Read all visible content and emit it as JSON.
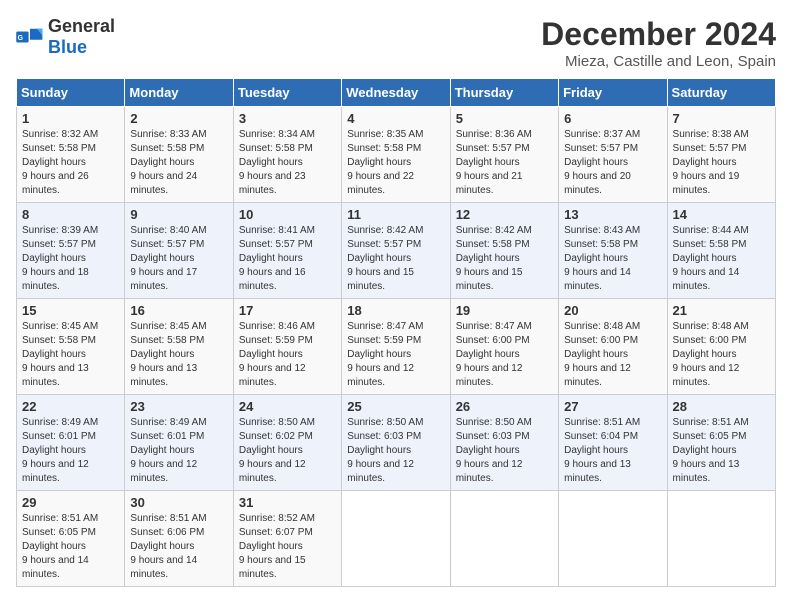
{
  "header": {
    "logo_general": "General",
    "logo_blue": "Blue",
    "title": "December 2024",
    "location": "Mieza, Castille and Leon, Spain"
  },
  "days_of_week": [
    "Sunday",
    "Monday",
    "Tuesday",
    "Wednesday",
    "Thursday",
    "Friday",
    "Saturday"
  ],
  "weeks": [
    [
      {
        "day": "1",
        "sunrise": "8:32 AM",
        "sunset": "5:58 PM",
        "daylight": "9 hours and 26 minutes."
      },
      {
        "day": "2",
        "sunrise": "8:33 AM",
        "sunset": "5:58 PM",
        "daylight": "9 hours and 24 minutes."
      },
      {
        "day": "3",
        "sunrise": "8:34 AM",
        "sunset": "5:58 PM",
        "daylight": "9 hours and 23 minutes."
      },
      {
        "day": "4",
        "sunrise": "8:35 AM",
        "sunset": "5:58 PM",
        "daylight": "9 hours and 22 minutes."
      },
      {
        "day": "5",
        "sunrise": "8:36 AM",
        "sunset": "5:57 PM",
        "daylight": "9 hours and 21 minutes."
      },
      {
        "day": "6",
        "sunrise": "8:37 AM",
        "sunset": "5:57 PM",
        "daylight": "9 hours and 20 minutes."
      },
      {
        "day": "7",
        "sunrise": "8:38 AM",
        "sunset": "5:57 PM",
        "daylight": "9 hours and 19 minutes."
      }
    ],
    [
      {
        "day": "8",
        "sunrise": "8:39 AM",
        "sunset": "5:57 PM",
        "daylight": "9 hours and 18 minutes."
      },
      {
        "day": "9",
        "sunrise": "8:40 AM",
        "sunset": "5:57 PM",
        "daylight": "9 hours and 17 minutes."
      },
      {
        "day": "10",
        "sunrise": "8:41 AM",
        "sunset": "5:57 PM",
        "daylight": "9 hours and 16 minutes."
      },
      {
        "day": "11",
        "sunrise": "8:42 AM",
        "sunset": "5:57 PM",
        "daylight": "9 hours and 15 minutes."
      },
      {
        "day": "12",
        "sunrise": "8:42 AM",
        "sunset": "5:58 PM",
        "daylight": "9 hours and 15 minutes."
      },
      {
        "day": "13",
        "sunrise": "8:43 AM",
        "sunset": "5:58 PM",
        "daylight": "9 hours and 14 minutes."
      },
      {
        "day": "14",
        "sunrise": "8:44 AM",
        "sunset": "5:58 PM",
        "daylight": "9 hours and 14 minutes."
      }
    ],
    [
      {
        "day": "15",
        "sunrise": "8:45 AM",
        "sunset": "5:58 PM",
        "daylight": "9 hours and 13 minutes."
      },
      {
        "day": "16",
        "sunrise": "8:45 AM",
        "sunset": "5:58 PM",
        "daylight": "9 hours and 13 minutes."
      },
      {
        "day": "17",
        "sunrise": "8:46 AM",
        "sunset": "5:59 PM",
        "daylight": "9 hours and 12 minutes."
      },
      {
        "day": "18",
        "sunrise": "8:47 AM",
        "sunset": "5:59 PM",
        "daylight": "9 hours and 12 minutes."
      },
      {
        "day": "19",
        "sunrise": "8:47 AM",
        "sunset": "6:00 PM",
        "daylight": "9 hours and 12 minutes."
      },
      {
        "day": "20",
        "sunrise": "8:48 AM",
        "sunset": "6:00 PM",
        "daylight": "9 hours and 12 minutes."
      },
      {
        "day": "21",
        "sunrise": "8:48 AM",
        "sunset": "6:00 PM",
        "daylight": "9 hours and 12 minutes."
      }
    ],
    [
      {
        "day": "22",
        "sunrise": "8:49 AM",
        "sunset": "6:01 PM",
        "daylight": "9 hours and 12 minutes."
      },
      {
        "day": "23",
        "sunrise": "8:49 AM",
        "sunset": "6:01 PM",
        "daylight": "9 hours and 12 minutes."
      },
      {
        "day": "24",
        "sunrise": "8:50 AM",
        "sunset": "6:02 PM",
        "daylight": "9 hours and 12 minutes."
      },
      {
        "day": "25",
        "sunrise": "8:50 AM",
        "sunset": "6:03 PM",
        "daylight": "9 hours and 12 minutes."
      },
      {
        "day": "26",
        "sunrise": "8:50 AM",
        "sunset": "6:03 PM",
        "daylight": "9 hours and 12 minutes."
      },
      {
        "day": "27",
        "sunrise": "8:51 AM",
        "sunset": "6:04 PM",
        "daylight": "9 hours and 13 minutes."
      },
      {
        "day": "28",
        "sunrise": "8:51 AM",
        "sunset": "6:05 PM",
        "daylight": "9 hours and 13 minutes."
      }
    ],
    [
      {
        "day": "29",
        "sunrise": "8:51 AM",
        "sunset": "6:05 PM",
        "daylight": "9 hours and 14 minutes."
      },
      {
        "day": "30",
        "sunrise": "8:51 AM",
        "sunset": "6:06 PM",
        "daylight": "9 hours and 14 minutes."
      },
      {
        "day": "31",
        "sunrise": "8:52 AM",
        "sunset": "6:07 PM",
        "daylight": "9 hours and 15 minutes."
      },
      null,
      null,
      null,
      null
    ]
  ],
  "labels": {
    "sunrise": "Sunrise:",
    "sunset": "Sunset:",
    "daylight": "Daylight hours"
  }
}
